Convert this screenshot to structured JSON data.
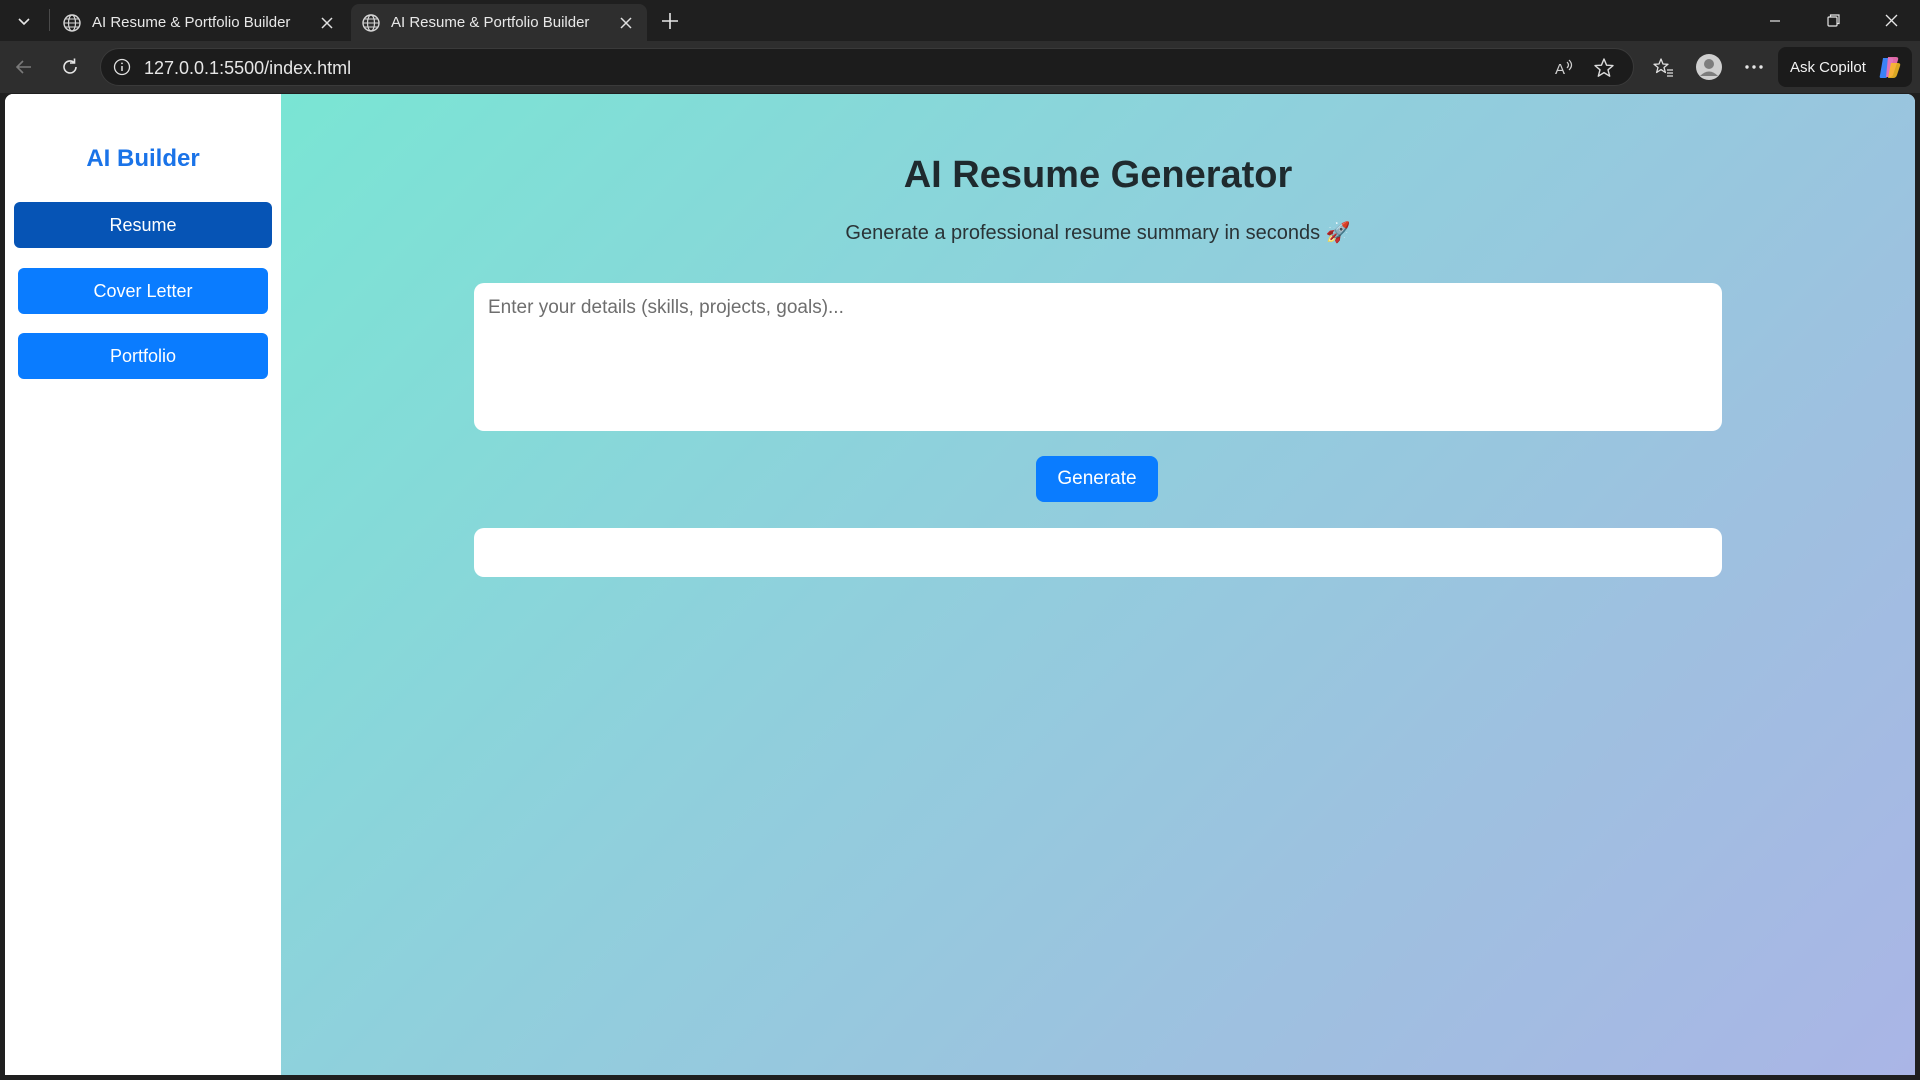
{
  "browser": {
    "tabs": [
      {
        "title": "AI Resume & Portfolio Builder",
        "active": false
      },
      {
        "title": "AI Resume & Portfolio Builder",
        "active": true
      }
    ],
    "url": "127.0.0.1:5500/index.html",
    "copilot_label": "Ask Copilot"
  },
  "sidebar": {
    "brand": "AI Builder",
    "items": [
      {
        "label": "Resume",
        "active": true
      },
      {
        "label": "Cover Letter",
        "active": false
      },
      {
        "label": "Portfolio",
        "active": false
      }
    ]
  },
  "main": {
    "title": "AI Resume Generator",
    "subtitle": "Generate a professional resume summary in seconds 🚀",
    "details_placeholder": "Enter your details (skills, projects, goals)...",
    "details_value": "",
    "generate_label": "Generate",
    "output_text": ""
  },
  "colors": {
    "accent": "#0a7cff",
    "accent_active": "#0654b5",
    "brand": "#1a73e8",
    "gradient_start": "#7ae5d4",
    "gradient_end": "#aab5e6"
  }
}
